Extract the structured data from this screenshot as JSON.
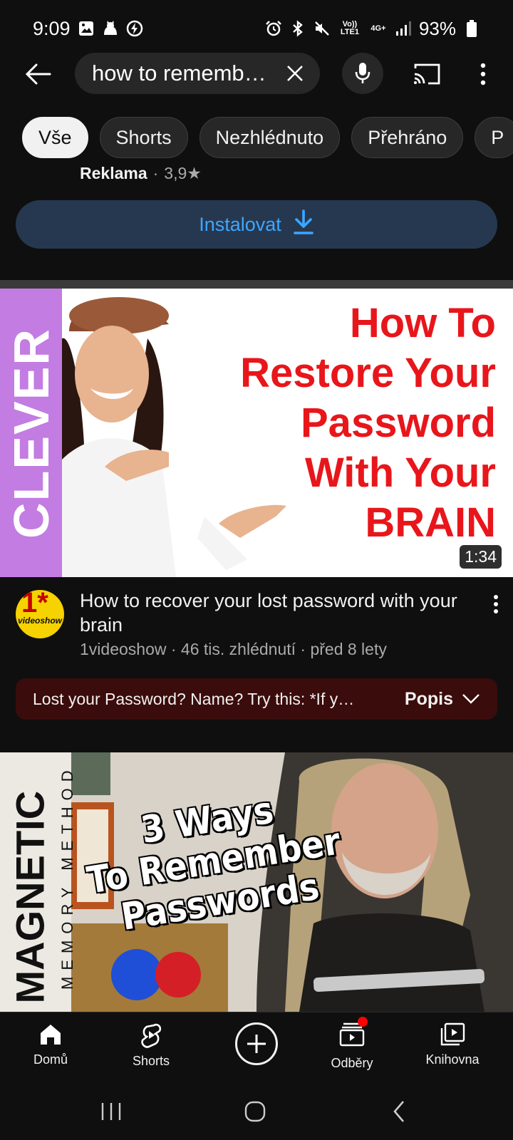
{
  "status_bar": {
    "time": "9:09",
    "battery": "93%",
    "network": "4G+",
    "volte": "Vo)) LTE1",
    "icons": [
      "gallery-icon",
      "cat-icon",
      "charging-icon",
      "alarm-icon",
      "bluetooth-icon",
      "mute-icon",
      "signal-icon",
      "battery-icon"
    ]
  },
  "search": {
    "query": "how to rememb…",
    "icons": [
      "back-arrow-icon",
      "close-icon",
      "mic-icon",
      "cast-icon",
      "more-vert-icon"
    ]
  },
  "chips": [
    {
      "label": "Vše",
      "active": true
    },
    {
      "label": "Shorts",
      "active": false
    },
    {
      "label": "Nezhlédnuto",
      "active": false
    },
    {
      "label": "Přehráno",
      "active": false
    },
    {
      "label": "P",
      "active": false
    }
  ],
  "ad": {
    "label": "Reklama",
    "separator": "·",
    "rating": "3,9★",
    "install_label": "Instalovat"
  },
  "video1": {
    "thumbnail": {
      "side_text": "CLEVER",
      "title_lines": [
        "How To",
        "Restore Your",
        "Password",
        "With Your",
        "BRAIN"
      ],
      "duration": "1:34"
    },
    "channel_avatar_text": "1*",
    "channel_avatar_sub": "videoshow",
    "title": "How to recover your lost password with your brain",
    "meta": "1videoshow · 46 tis. zhlédnutí · před 8 lety",
    "description": "Lost your Password? Name? Try this: *If y…",
    "description_toggle": "Popis"
  },
  "video2": {
    "thumbnail": {
      "side_text": "MAGNETIC",
      "side_sub": "MEMORY METHOD",
      "title_lines": [
        "3 Ways",
        "To Remember",
        "Passwords"
      ]
    }
  },
  "bottom_nav": {
    "home": "Domů",
    "shorts": "Shorts",
    "subscriptions": "Odběry",
    "library": "Knihovna"
  },
  "colors": {
    "background": "#0f0f0f",
    "chip_bg": "#272727",
    "accent_blue": "#3ea6ff",
    "install_bg": "#263850",
    "thumb_title_red": "#e8161b",
    "clever_band": "#c27ce2",
    "desc_bg": "#3b0c0c",
    "notification": "#ff0000"
  }
}
